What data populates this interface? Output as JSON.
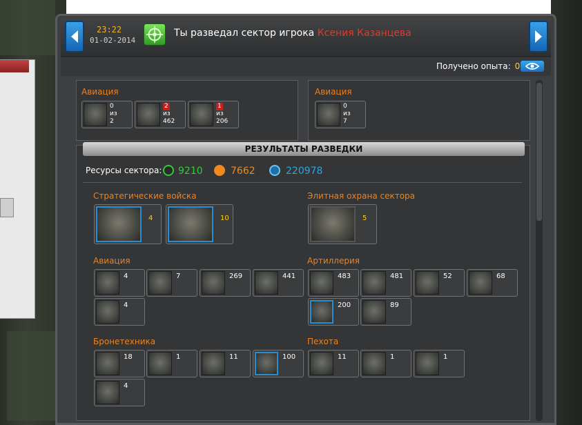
{
  "header": {
    "time": "23:22",
    "date": "01-02-2014",
    "message": "Ты разведал сектор игрока",
    "player": "Ксения Казанцева"
  },
  "xp": {
    "label": "Получено опыта:",
    "value": "0"
  },
  "top": {
    "left": {
      "title": "Авиация",
      "units": [
        {
          "icon": "spider-unit-icon",
          "l1": "0",
          "l2": "из",
          "l3": "2",
          "lost": false
        },
        {
          "icon": "mech-unit-icon",
          "l1": "2",
          "l2": "из",
          "l3": "462",
          "lost": true
        },
        {
          "icon": "walker-unit-icon",
          "l1": "1",
          "l2": "из",
          "l3": "206",
          "lost": true
        }
      ]
    },
    "right": {
      "title": "Авиация",
      "units": [
        {
          "icon": "walker-unit-icon",
          "l1": "0",
          "l2": "из",
          "l3": "7",
          "lost": false
        }
      ]
    }
  },
  "results": {
    "title": "РЕЗУЛЬТАТЫ РАЗВЕДКИ",
    "resources_label": "Ресурсы сектора:",
    "resources": [
      {
        "icon": "radiation-icon",
        "value": "9210",
        "color": "#33cc33"
      },
      {
        "icon": "titanium-icon",
        "value": "7662",
        "color": "#f08a1e"
      },
      {
        "icon": "credits-icon",
        "value": "220978",
        "color": "#2aa7e0"
      }
    ]
  },
  "sections": {
    "strategic": {
      "title": "Стратегические войска",
      "units": [
        {
          "count": "4"
        },
        {
          "count": "10"
        }
      ]
    },
    "elite": {
      "title": "Элитная охрана сектора",
      "units": [
        {
          "count": "5"
        }
      ]
    },
    "aviation": {
      "title": "Авиация",
      "units": [
        {
          "count": "4"
        },
        {
          "count": "7"
        },
        {
          "count": "269"
        },
        {
          "count": "441"
        },
        {
          "count": "4"
        }
      ]
    },
    "artillery": {
      "title": "Артиллерия",
      "units": [
        {
          "count": "483"
        },
        {
          "count": "481"
        },
        {
          "count": "52"
        },
        {
          "count": "68"
        },
        {
          "count": "200"
        },
        {
          "count": "89"
        }
      ]
    },
    "armor": {
      "title": "Бронетехника",
      "units": [
        {
          "count": "18"
        },
        {
          "count": "1"
        },
        {
          "count": "11"
        },
        {
          "count": "100"
        },
        {
          "count": "4"
        }
      ]
    },
    "infantry": {
      "title": "Пехота",
      "units": [
        {
          "count": "11"
        },
        {
          "count": "1"
        },
        {
          "count": "1"
        }
      ]
    }
  }
}
